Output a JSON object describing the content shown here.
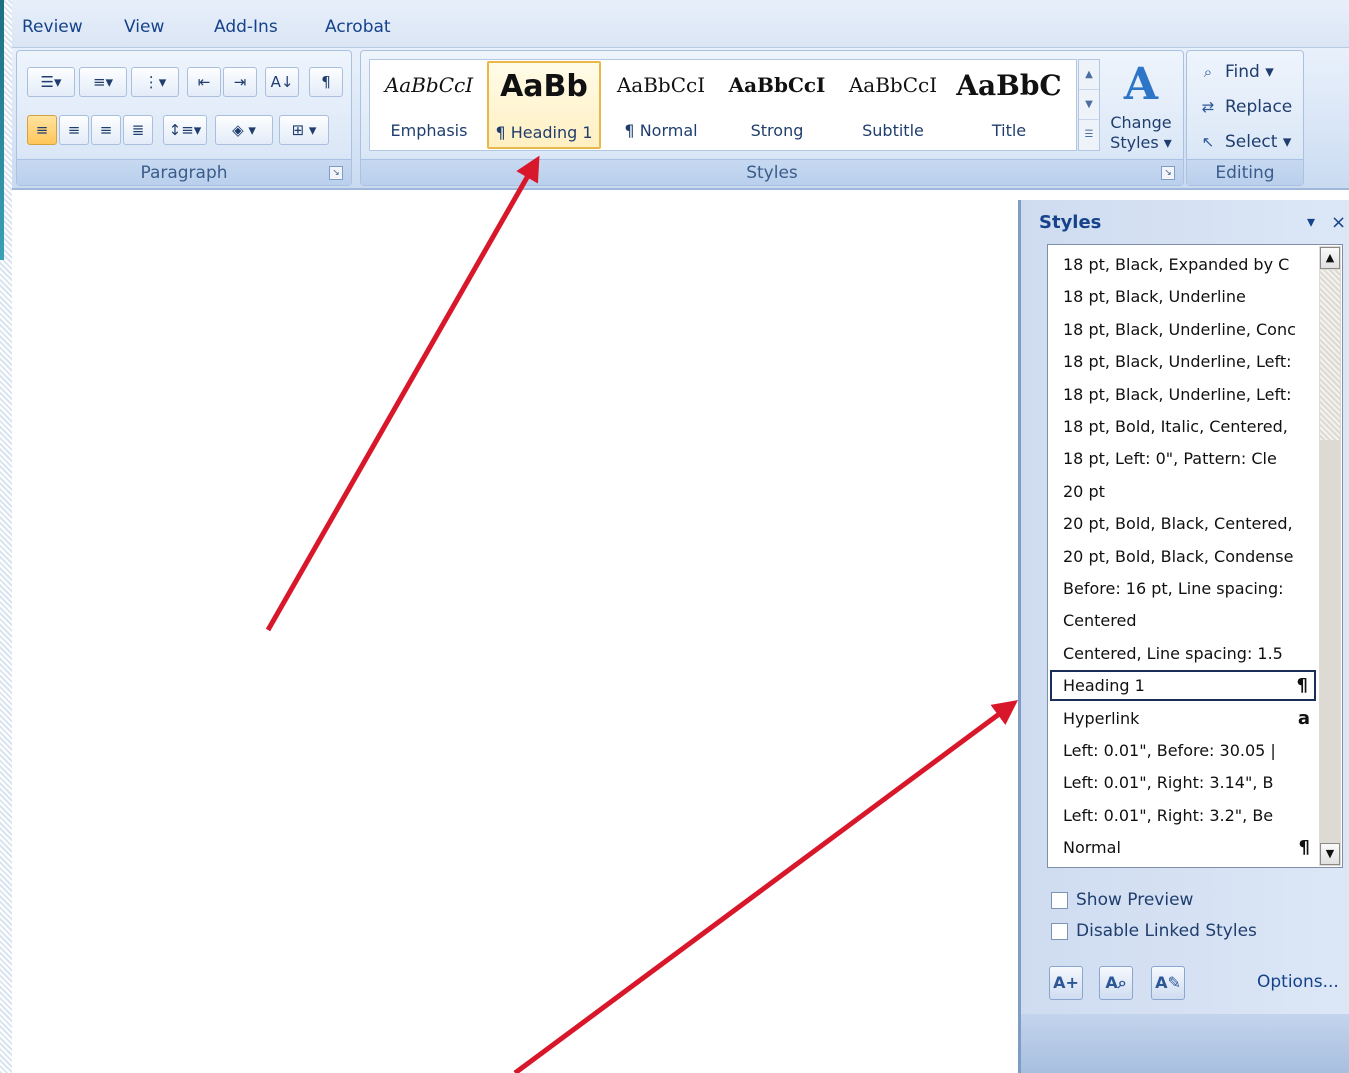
{
  "ribbon": {
    "tabs": [
      "Review",
      "View",
      "Add-Ins",
      "Acrobat"
    ],
    "groups": {
      "paragraph": "Paragraph",
      "styles": "Styles",
      "editing": "Editing"
    },
    "paragraph_buttons": {
      "show_marks": "¶",
      "sort": "A↓"
    },
    "gallery": [
      {
        "sample": "AaBbCcI",
        "name": "Emphasis"
      },
      {
        "sample": "AaBb",
        "name": "¶ Heading 1"
      },
      {
        "sample": "AaBbCcI",
        "name": "¶ Normal"
      },
      {
        "sample": "AaBbCcI",
        "name": "Strong"
      },
      {
        "sample": "AaBbCcI",
        "name": "Subtitle"
      },
      {
        "sample": "AaBbC",
        "name": "Title"
      }
    ],
    "change_styles": {
      "line1": "Change",
      "line2": "Styles ▾"
    },
    "editing": {
      "find": "Find ▾",
      "replace": "Replace",
      "select": "Select ▾"
    }
  },
  "pane": {
    "title": "Styles",
    "menu_glyph": "▾",
    "close_glyph": "×",
    "items": [
      {
        "label": "18 pt, Black, Expanded by  C",
        "mark": ""
      },
      {
        "label": "18 pt, Black, Underline",
        "mark": ""
      },
      {
        "label": "18 pt, Black, Underline, Conc",
        "mark": ""
      },
      {
        "label": "18 pt, Black, Underline, Left:",
        "mark": ""
      },
      {
        "label": "18 pt, Black, Underline, Left:",
        "mark": ""
      },
      {
        "label": "18 pt, Bold, Italic, Centered,",
        "mark": ""
      },
      {
        "label": "18 pt, Left:  0\", Pattern: Cle",
        "mark": ""
      },
      {
        "label": "20 pt",
        "mark": ""
      },
      {
        "label": "20 pt, Bold, Black, Centered,",
        "mark": ""
      },
      {
        "label": "20 pt, Bold, Black, Condense",
        "mark": ""
      },
      {
        "label": "Before:  16 pt, Line spacing:",
        "mark": ""
      },
      {
        "label": "Centered",
        "mark": ""
      },
      {
        "label": "Centered, Line spacing:  1.5",
        "mark": ""
      },
      {
        "label": "Heading 1",
        "mark": "¶"
      },
      {
        "label": "Hyperlink",
        "mark": "a"
      },
      {
        "label": "Left:  0.01\", Before:  30.05 |",
        "mark": ""
      },
      {
        "label": "Left:  0.01\", Right:  3.14\", B",
        "mark": ""
      },
      {
        "label": "Left:  0.01\", Right:  3.2\", Be",
        "mark": ""
      },
      {
        "label": "Normal",
        "mark": "¶"
      }
    ],
    "selected_index": 13,
    "show_preview": "Show Preview",
    "disable_linked": "Disable Linked Styles",
    "options": "Options..."
  },
  "colors": {
    "arrow": "#d9172a",
    "ribbon_text": "#15428b",
    "selected_style_border": "#e8b84b"
  }
}
